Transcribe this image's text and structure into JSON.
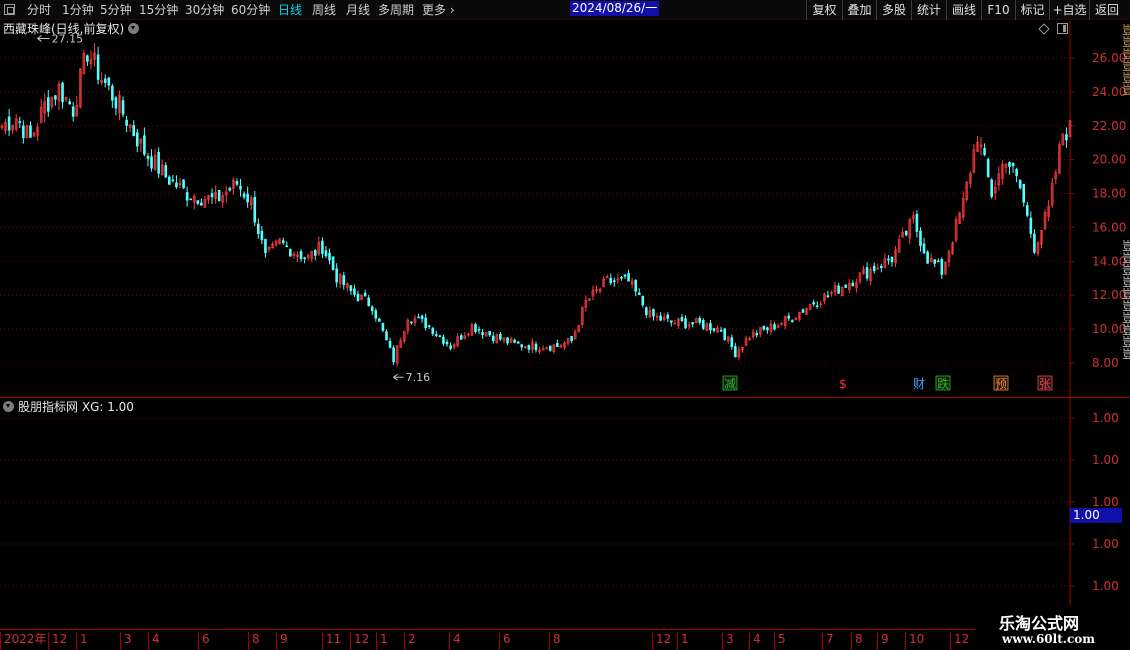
{
  "toolbar": {
    "periods": [
      "分时",
      "1分钟",
      "5分钟",
      "15分钟",
      "30分钟",
      "60分钟",
      "日线",
      "周线",
      "月线",
      "多周期",
      "更多"
    ],
    "active_period": "日线",
    "more_icon": "chevron-right-icon",
    "buttons": [
      "复权",
      "叠加",
      "多股",
      "统计",
      "画线",
      "F10",
      "标记",
      "+自选",
      "返回"
    ]
  },
  "price_chart": {
    "title": "西藏珠峰(日线,前复权)",
    "y_axis_labels": [
      "26.00",
      "24.00",
      "22.00",
      "20.00",
      "18.00",
      "16.00",
      "14.00",
      "12.00",
      "10.00",
      "8.00"
    ],
    "max_annotation": "27.15",
    "min_annotation": "7.16",
    "event_markers": [
      {
        "text": "减",
        "color": "#20c020",
        "box": true
      },
      {
        "text": "$",
        "color": "#ff3030",
        "box": false
      },
      {
        "text": "财",
        "color": "#4aa0ff",
        "box": false
      },
      {
        "text": "跌",
        "color": "#20c020",
        "box": true
      },
      {
        "text": "预",
        "color": "#ff8020",
        "box": true
      },
      {
        "text": "张",
        "color": "#ff4040",
        "box": true
      }
    ],
    "colors": {
      "up": "#ff3c3c",
      "down": "#54ffff",
      "grid": "#7a0000",
      "axis": "#d03030"
    }
  },
  "indicator": {
    "title": "股朋指标网",
    "value_label": "XG: 1.00",
    "axis_labels": [
      "1.00",
      "1.00",
      "1.00",
      "1.00",
      "1.00"
    ],
    "current_value": "1.00"
  },
  "time_axis": {
    "ticks": [
      "2022年",
      "12",
      "1",
      "3",
      "4",
      "6",
      "8",
      "9",
      "11",
      "12",
      "1",
      "2",
      "4",
      "6",
      "8",
      "12",
      "1",
      "3",
      "4",
      "5",
      "7",
      "8",
      "9",
      "10",
      "12"
    ],
    "cursor_date": "2024/08/26/一"
  },
  "watermark": {
    "line1": "乐淘公式网",
    "line2": "www.60lt.com"
  },
  "chart_data": {
    "type": "candlestick",
    "title": "西藏珠峰(日线,前复权)",
    "x_start": "2022",
    "ylim": [
      6.5,
      27.5
    ],
    "y_ticks": [
      8,
      10,
      12,
      14,
      16,
      18,
      20,
      22,
      24,
      26
    ],
    "close_path": [
      [
        0,
        22.0
      ],
      [
        4,
        22.5
      ],
      [
        8,
        21.2
      ],
      [
        12,
        23.2
      ],
      [
        16,
        24.2
      ],
      [
        20,
        23.0
      ],
      [
        24,
        26.4
      ],
      [
        28,
        24.8
      ],
      [
        32,
        23.5
      ],
      [
        40,
        20.5
      ],
      [
        46,
        19.0
      ],
      [
        52,
        18.0
      ],
      [
        60,
        17.6
      ],
      [
        66,
        18.6
      ],
      [
        70,
        17.5
      ],
      [
        74,
        14.2
      ],
      [
        78,
        15.1
      ],
      [
        82,
        14.6
      ],
      [
        86,
        14.2
      ],
      [
        90,
        14.9
      ],
      [
        94,
        13.1
      ],
      [
        98,
        12.2
      ],
      [
        104,
        11.4
      ],
      [
        110,
        8.2
      ],
      [
        114,
        10.8
      ],
      [
        120,
        10.2
      ],
      [
        126,
        9.0
      ],
      [
        132,
        10.2
      ],
      [
        138,
        9.6
      ],
      [
        144,
        9.1
      ],
      [
        150,
        9.0
      ],
      [
        156,
        9.0
      ],
      [
        160,
        9.3
      ],
      [
        164,
        11.6
      ],
      [
        170,
        12.8
      ],
      [
        176,
        12.8
      ],
      [
        182,
        10.8
      ],
      [
        188,
        10.4
      ],
      [
        196,
        10.3
      ],
      [
        202,
        10.0
      ],
      [
        206,
        8.6
      ],
      [
        210,
        9.6
      ],
      [
        216,
        10.1
      ],
      [
        222,
        10.7
      ],
      [
        228,
        11.6
      ],
      [
        232,
        12.0
      ],
      [
        238,
        12.8
      ],
      [
        244,
        13.5
      ],
      [
        250,
        14.2
      ],
      [
        256,
        16.4
      ],
      [
        260,
        14.2
      ],
      [
        264,
        13.4
      ],
      [
        270,
        17.4
      ],
      [
        274,
        21.5
      ],
      [
        278,
        18.0
      ],
      [
        282,
        20.2
      ],
      [
        286,
        18.3
      ],
      [
        290,
        14.9
      ],
      [
        294,
        17.0
      ],
      [
        298,
        21.6
      ],
      [
        300,
        21.8
      ]
    ],
    "max": {
      "value": 27.15,
      "index": 10
    },
    "min": {
      "value": 7.16,
      "index": 110
    },
    "indicator_series": {
      "name": "XG",
      "constant_value": 1.0
    }
  }
}
